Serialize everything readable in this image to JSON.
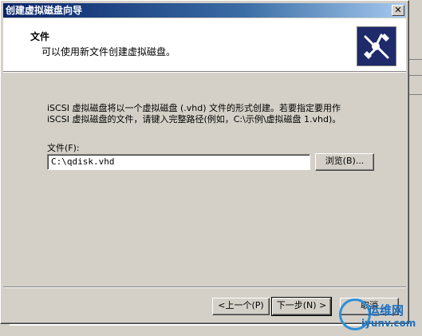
{
  "window": {
    "title": "创建虚拟磁盘向导",
    "close_glyph": "✕"
  },
  "header": {
    "title": "文件",
    "subtitle": "可以使用新文件创建虚拟磁盘。"
  },
  "body": {
    "line1": "iSCSI 虚拟磁盘将以一个虚拟磁盘 (.vhd) 文件的形式创建。若要指定要用作",
    "line2": "iSCSI 虚拟磁盘的文件，请键入完整路径(例如，C:\\示例\\虚拟磁盘 1.vhd)。"
  },
  "file": {
    "label": "文件(F):",
    "value": "C:\\qdisk.vhd",
    "browse_label": "浏览(B)..."
  },
  "footer": {
    "back_label": "<上一个(P)",
    "next_label": "下一步(N) >",
    "cancel_label": "取消"
  },
  "watermark": {
    "line1": "运维网",
    "line2": "iyunv.com"
  },
  "colors": {
    "titlebar": "#0a246a",
    "face": "#d4d0c8",
    "header_icon": "#1f2a6b"
  }
}
